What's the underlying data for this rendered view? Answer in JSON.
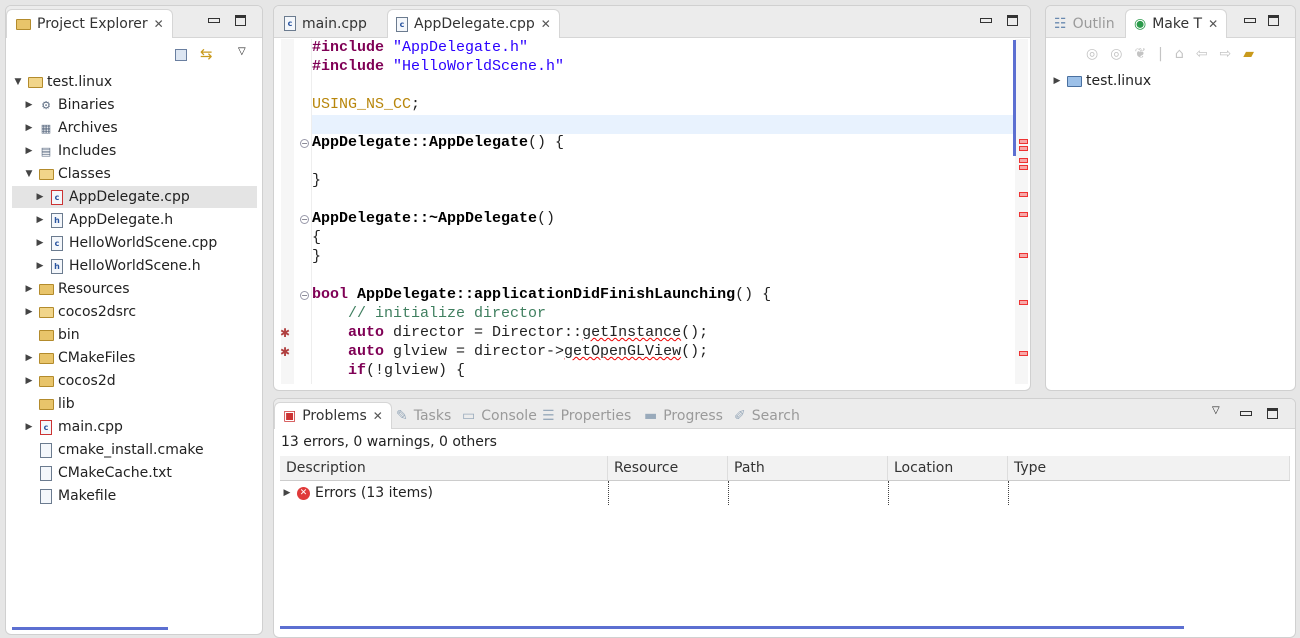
{
  "project_explorer": {
    "title": "Project Explorer",
    "tree": [
      {
        "label": "test.linux",
        "level": 0,
        "expanded": true,
        "icon": "c-project-icon"
      },
      {
        "label": "Binaries",
        "level": 1,
        "icon": "binaries-icon"
      },
      {
        "label": "Archives",
        "level": 1,
        "icon": "archives-icon"
      },
      {
        "label": "Includes",
        "level": 1,
        "icon": "includes-icon"
      },
      {
        "label": "Classes",
        "level": 1,
        "expanded": true,
        "icon": "source-folder-icon"
      },
      {
        "label": "AppDelegate.cpp",
        "level": 2,
        "selected": true,
        "icon": "cpp-file-error-icon"
      },
      {
        "label": "AppDelegate.h",
        "level": 2,
        "icon": "header-file-icon"
      },
      {
        "label": "HelloWorldScene.cpp",
        "level": 2,
        "icon": "cpp-file-icon"
      },
      {
        "label": "HelloWorldScene.h",
        "level": 2,
        "icon": "header-file-icon"
      },
      {
        "label": "Resources",
        "level": 1,
        "icon": "folder-icon"
      },
      {
        "label": "cocos2dsrc",
        "level": 1,
        "icon": "source-folder-icon"
      },
      {
        "label": "bin",
        "level": 1,
        "leaf": true,
        "icon": "folder-icon"
      },
      {
        "label": "CMakeFiles",
        "level": 1,
        "icon": "folder-icon"
      },
      {
        "label": "cocos2d",
        "level": 1,
        "icon": "folder-icon"
      },
      {
        "label": "lib",
        "level": 1,
        "leaf": true,
        "icon": "folder-icon"
      },
      {
        "label": "main.cpp",
        "level": 1,
        "icon": "cpp-file-error-icon"
      },
      {
        "label": "cmake_install.cmake",
        "level": 1,
        "leaf": true,
        "icon": "cmake-file-icon"
      },
      {
        "label": "CMakeCache.txt",
        "level": 1,
        "leaf": true,
        "icon": "text-file-icon"
      },
      {
        "label": "Makefile",
        "level": 1,
        "leaf": true,
        "icon": "makefile-icon"
      }
    ]
  },
  "editor": {
    "tabs": [
      {
        "label": "main.cpp",
        "active": false
      },
      {
        "label": "AppDelegate.cpp",
        "active": true
      }
    ],
    "lines": {
      "l0a": "#include",
      "l0b": " \"AppDelegate.h\"",
      "l1a": "#include",
      "l1b": " \"HelloWorldScene.h\"",
      "l3": "USING_NS_CC",
      "l3b": ";",
      "l5": "AppDelegate::AppDelegate",
      "l5b": "() {",
      "l7": "}",
      "l9": "AppDelegate::~AppDelegate",
      "l9b": "()",
      "l10": "{",
      "l11": "}",
      "l13a": "bool",
      "l13b": " AppDelegate::applicationDidFinishLaunching",
      "l13c": "() {",
      "l14": "    // initialize director",
      "l15a": "    auto",
      "l15b": " director = Director::",
      "l15c": "getInstance",
      "l15d": "();",
      "l16a": "    auto",
      "l16b": " glview = director->",
      "l16c": "getOpenGLView",
      "l16d": "();",
      "l17a": "    if",
      "l17b": "(!glview) {"
    }
  },
  "right_panel": {
    "tabs": [
      {
        "label": "Outlin",
        "active": false
      },
      {
        "label": "Make T",
        "active": true
      }
    ],
    "tree": [
      {
        "label": "test.linux"
      }
    ]
  },
  "bottom_panel": {
    "tabs": [
      {
        "label": "Problems",
        "active": true
      },
      {
        "label": "Tasks"
      },
      {
        "label": "Console"
      },
      {
        "label": "Properties"
      },
      {
        "label": "Progress"
      },
      {
        "label": "Search"
      }
    ],
    "summary": "13 errors, 0 warnings, 0 others",
    "columns": [
      "Description",
      "Resource",
      "Path",
      "Location",
      "Type"
    ],
    "rows": [
      {
        "description": "Errors (13 items)"
      }
    ]
  },
  "colors": {
    "keyword": "#7f0055",
    "string": "#2a00ff",
    "comment": "#3f7f5f",
    "macro": "#b8860b",
    "error": "#e33333",
    "accent": "#5c6fd1"
  }
}
